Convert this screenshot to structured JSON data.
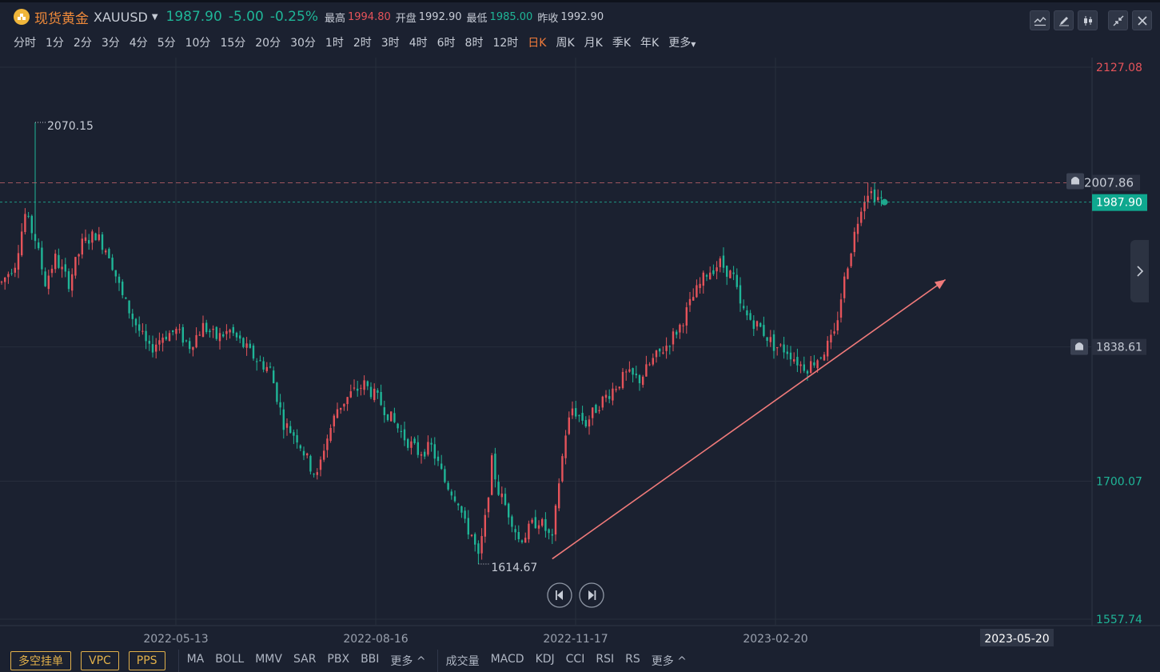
{
  "header": {
    "instrument_name": "现货黄金",
    "instrument_code": "XAUUSD",
    "last_price": "1987.90",
    "change": "-5.00",
    "change_pct": "-0.25%",
    "high_label": "最高",
    "high_value": "1994.80",
    "open_label": "开盘",
    "open_value": "1992.90",
    "low_label": "最低",
    "low_value": "1985.00",
    "prev_close_label": "昨收",
    "prev_close_value": "1992.90",
    "tool_icons": [
      "indicator-icon",
      "draw-pencil-icon",
      "candlestick-icon",
      "collapse-arrows-icon",
      "close-icon"
    ]
  },
  "periods": [
    "分时",
    "1分",
    "2分",
    "3分",
    "4分",
    "5分",
    "10分",
    "15分",
    "20分",
    "30分",
    "1时",
    "2时",
    "3时",
    "4时",
    "6时",
    "8时",
    "12时",
    "日K",
    "周K",
    "月K",
    "季K",
    "年K",
    "更多"
  ],
  "active_period": "日K",
  "colors": {
    "up": "#e5535a",
    "down": "#1fb597",
    "accent": "#f07a3a",
    "background": "#1b2130"
  },
  "chart_data": {
    "type": "candlestick",
    "y_axis_labels": [
      {
        "value": 2127.08,
        "label": "2127.08",
        "color": "#e5535a"
      },
      {
        "value": 1838.61,
        "label": "1838.61",
        "color": "#c7ccd6"
      },
      {
        "value": 1700.07,
        "label": "1700.07",
        "color": "#1fb597"
      },
      {
        "value": 1557.74,
        "label": "1557.74",
        "color": "#1fb597"
      }
    ],
    "x_axis_labels": [
      "2022-05-13",
      "2022-08-16",
      "2022-11-17",
      "2023-02-20"
    ],
    "crosshair_date": "2023-05-20",
    "ylim": [
      1557.74,
      2127.08
    ],
    "annotations": {
      "max_label": "2070.15",
      "min_label": "1614.67"
    },
    "alert_line": {
      "value": 2007.86,
      "label": "2007.86"
    },
    "current_price": {
      "value": 1987.9,
      "label": "1987.90"
    },
    "trend_arrow": {
      "from_date_index": 164,
      "from_value": 1620,
      "to_date_index": 243,
      "to_value": 1908
    },
    "path_anchors": [
      [
        0,
        1905
      ],
      [
        4,
        1925
      ],
      [
        7,
        1975
      ],
      [
        10,
        1950
      ],
      [
        13,
        1905
      ],
      [
        16,
        1930
      ],
      [
        20,
        1905
      ],
      [
        24,
        1945
      ],
      [
        28,
        1955
      ],
      [
        32,
        1935
      ],
      [
        36,
        1890
      ],
      [
        40,
        1862
      ],
      [
        44,
        1835
      ],
      [
        48,
        1850
      ],
      [
        52,
        1855
      ],
      [
        56,
        1840
      ],
      [
        60,
        1860
      ],
      [
        64,
        1848
      ],
      [
        68,
        1855
      ],
      [
        72,
        1840
      ],
      [
        76,
        1825
      ],
      [
        80,
        1815
      ],
      [
        84,
        1760
      ],
      [
        88,
        1745
      ],
      [
        92,
        1715
      ],
      [
        94,
        1705
      ],
      [
        96,
        1735
      ],
      [
        100,
        1775
      ],
      [
        104,
        1790
      ],
      [
        108,
        1800
      ],
      [
        112,
        1785
      ],
      [
        116,
        1765
      ],
      [
        120,
        1745
      ],
      [
        124,
        1730
      ],
      [
        128,
        1735
      ],
      [
        132,
        1700
      ],
      [
        136,
        1680
      ],
      [
        138,
        1655
      ],
      [
        140,
        1645
      ],
      [
        142,
        1620
      ],
      [
        144,
        1660
      ],
      [
        146,
        1720
      ],
      [
        148,
        1690
      ],
      [
        150,
        1675
      ],
      [
        152,
        1660
      ],
      [
        154,
        1640
      ],
      [
        156,
        1645
      ],
      [
        158,
        1655
      ],
      [
        160,
        1660
      ],
      [
        162,
        1650
      ],
      [
        164,
        1638
      ],
      [
        166,
        1700
      ],
      [
        168,
        1750
      ],
      [
        170,
        1775
      ],
      [
        174,
        1760
      ],
      [
        178,
        1780
      ],
      [
        182,
        1795
      ],
      [
        186,
        1810
      ],
      [
        190,
        1805
      ],
      [
        194,
        1825
      ],
      [
        198,
        1840
      ],
      [
        202,
        1860
      ],
      [
        206,
        1890
      ],
      [
        210,
        1915
      ],
      [
        214,
        1925
      ],
      [
        218,
        1910
      ],
      [
        220,
        1880
      ],
      [
        222,
        1870
      ],
      [
        226,
        1858
      ],
      [
        230,
        1840
      ],
      [
        234,
        1835
      ],
      [
        238,
        1820
      ],
      [
        240,
        1818
      ],
      [
        244,
        1830
      ],
      [
        246,
        1840
      ],
      [
        248,
        1850
      ],
      [
        250,
        1890
      ],
      [
        252,
        1925
      ],
      [
        254,
        1955
      ],
      [
        256,
        1985
      ],
      [
        258,
        2000
      ],
      [
        260,
        1995
      ],
      [
        262,
        1990
      ]
    ]
  },
  "nav_icons": [
    "skip-back-icon",
    "skip-forward-icon"
  ],
  "bottom": {
    "order_buttons": [
      "多空挂单",
      "VPC",
      "PPS"
    ],
    "main_indicators": [
      "MA",
      "BOLL",
      "MMV",
      "SAR",
      "PBX",
      "BBI",
      "更多 ^"
    ],
    "sub_indicators": [
      "成交量",
      "MACD",
      "KDJ",
      "CCI",
      "RSI",
      "RS",
      "更多 ^"
    ]
  }
}
